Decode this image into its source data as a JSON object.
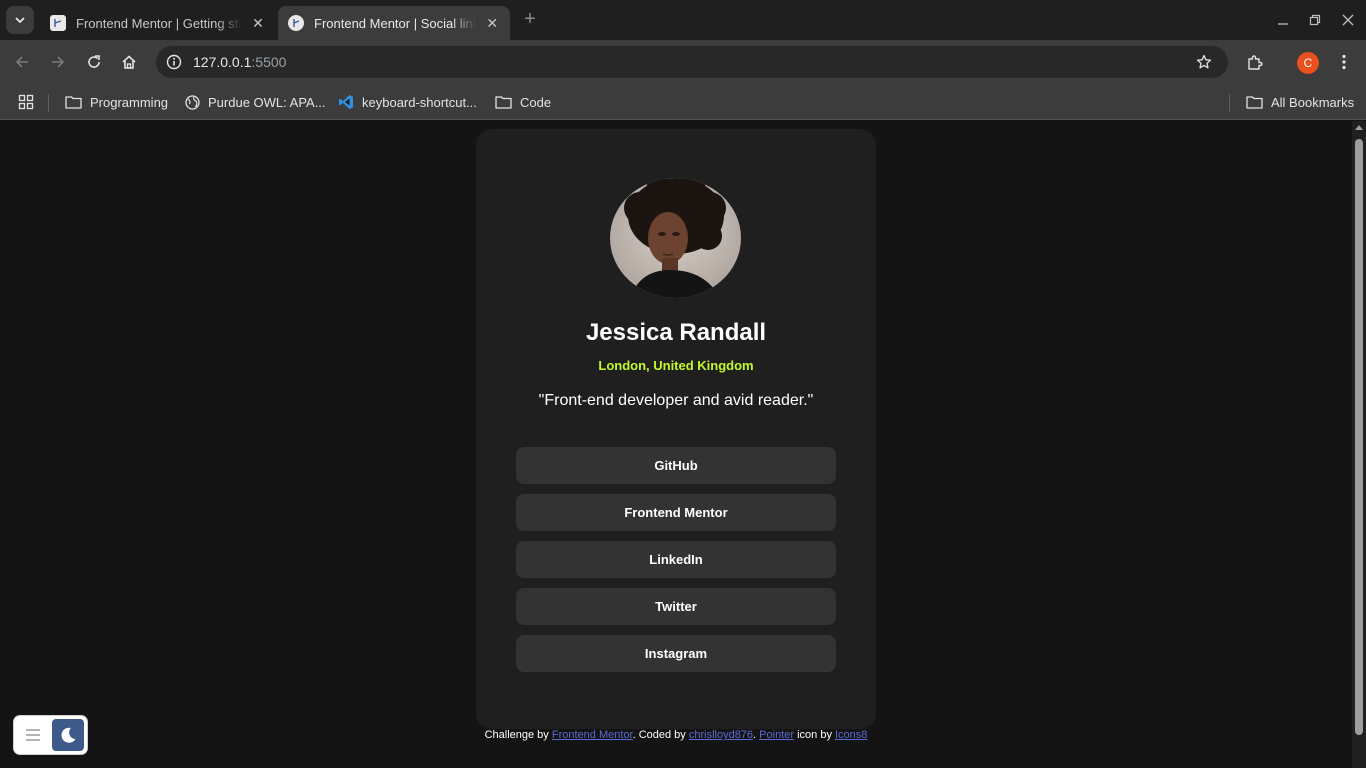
{
  "browser": {
    "tabs": [
      {
        "title": "Frontend Mentor | Getting started",
        "active": false
      },
      {
        "title": "Frontend Mentor | Social links profile",
        "active": true
      }
    ],
    "address": {
      "host": "127.0.0.1",
      "port": ":5500"
    },
    "profile_initial": "C",
    "bookmarks": [
      {
        "label": "Programming",
        "icon": "folder-icon"
      },
      {
        "label": "Purdue OWL: APA...",
        "icon": "globe-icon"
      },
      {
        "label": "keyboard-shortcut...",
        "icon": "vscode-icon"
      },
      {
        "label": "Code",
        "icon": "folder-icon"
      }
    ],
    "all_bookmarks": "All Bookmarks"
  },
  "profile": {
    "name": "Jessica Randall",
    "location": "London, United Kingdom",
    "bio": "\"Front-end developer and avid reader.\"",
    "links": [
      "GitHub",
      "Frontend Mentor",
      "LinkedIn",
      "Twitter",
      "Instagram"
    ]
  },
  "attribution": {
    "prefix": "Challenge by ",
    "link1": "Frontend Mentor",
    "mid1": ". Coded by ",
    "link2": "chrislloyd876",
    "mid2": ". ",
    "link3": "Pointer",
    "mid3": " icon by ",
    "link4": "Icons8"
  },
  "colors": {
    "accent_location": "#c4f82a",
    "card_bg": "#1f1f1f",
    "button_bg": "#333333",
    "page_bg": "#141414"
  }
}
